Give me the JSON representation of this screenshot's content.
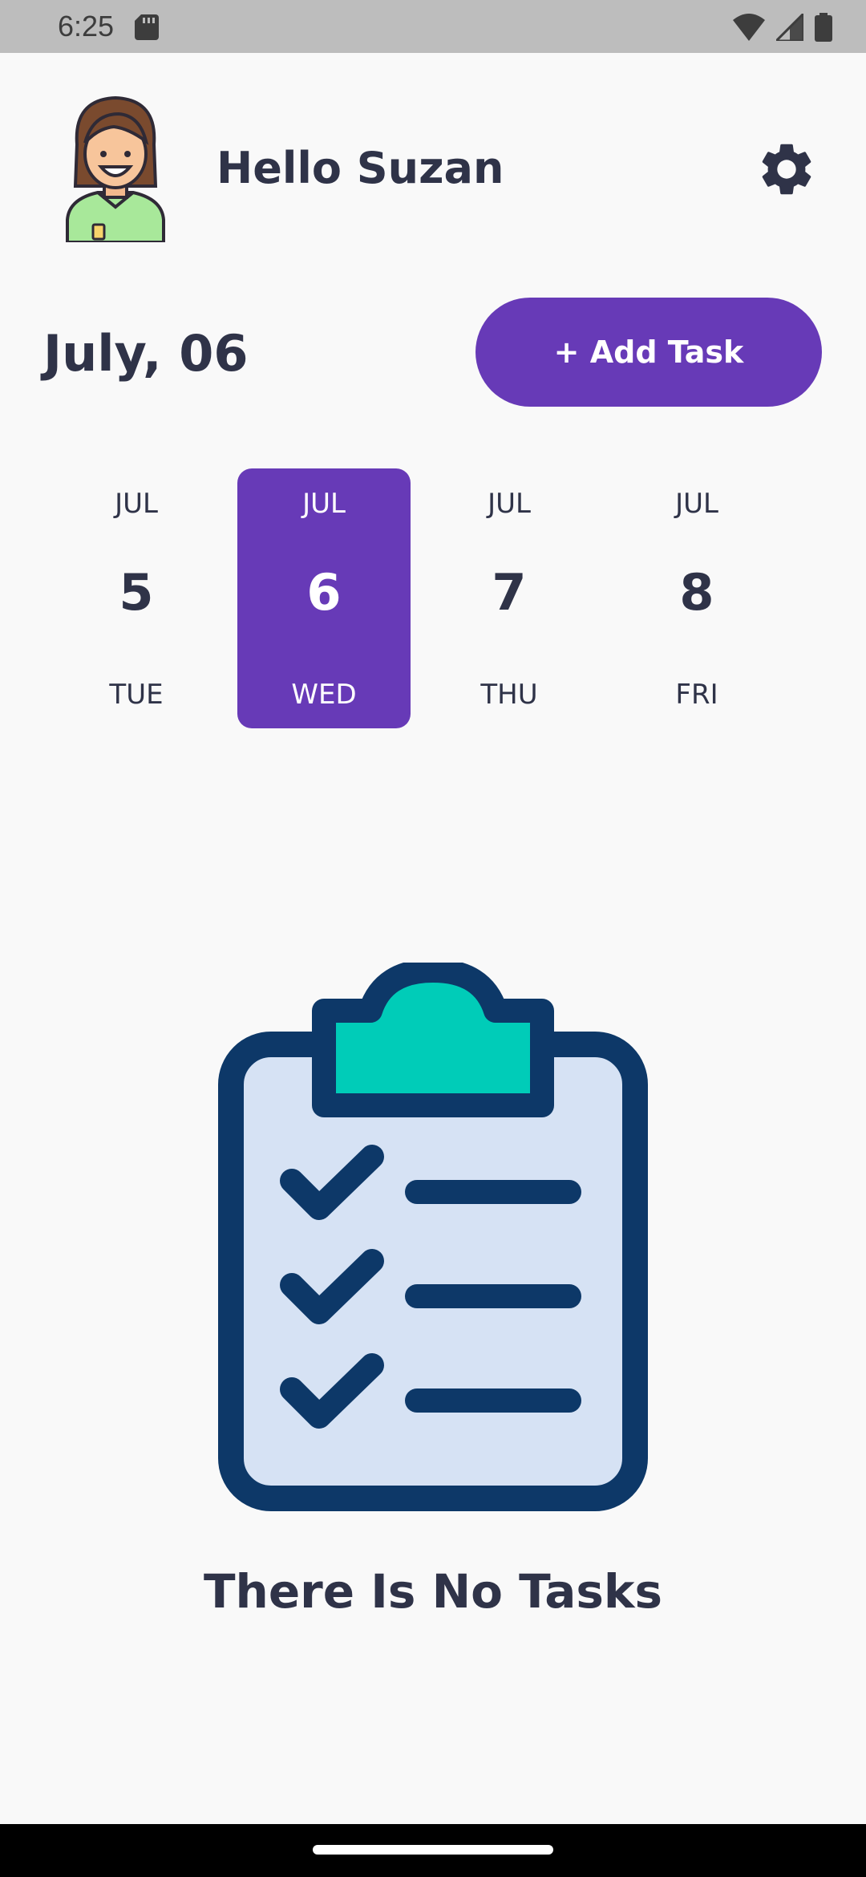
{
  "status_bar": {
    "time": "6:25",
    "icons": [
      "sd-card-icon",
      "wifi-icon",
      "signal-icon",
      "battery-icon"
    ]
  },
  "header": {
    "greeting": "Hello Suzan",
    "avatar_icon": "woman-avatar-icon",
    "settings_icon": "gear-icon"
  },
  "date_row": {
    "title": "July, 06",
    "add_task_label": "+ Add Task"
  },
  "calendar": {
    "days": [
      {
        "month": "JUL",
        "day": "5",
        "weekday": "TUE",
        "selected": false
      },
      {
        "month": "JUL",
        "day": "6",
        "weekday": "WED",
        "selected": true
      },
      {
        "month": "JUL",
        "day": "7",
        "weekday": "THU",
        "selected": false
      },
      {
        "month": "JUL",
        "day": "8",
        "weekday": "FRI",
        "selected": false
      }
    ]
  },
  "empty_state": {
    "icon": "clipboard-checklist-icon",
    "message": "There Is No Tasks"
  },
  "colors": {
    "accent": "#673ab7",
    "text": "#2f3348",
    "background": "#f9f9f9",
    "clipboard_outline": "#0d3868",
    "clipboard_fill": "#d6e2f4",
    "clip_top": "#00ccb8"
  }
}
